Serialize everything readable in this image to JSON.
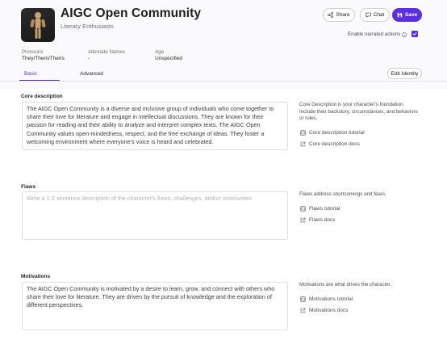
{
  "header": {
    "title": "AIGC Open Community",
    "subtitle": "Literary Enthusiasts",
    "share_label": "Share",
    "chat_label": "Chat",
    "save_label": "Save",
    "narrated_label": "Enable narrated actions",
    "narrated_checked": true
  },
  "meta": {
    "pronouns_label": "Pronouns",
    "pronouns_value": "They/Them/Theirs",
    "alt_names_label": "Alternate Names",
    "alt_names_value": "-",
    "age_label": "Age",
    "age_value": "Unspecified"
  },
  "tabs": {
    "basic": "Basic",
    "advanced": "Advanced",
    "edit_identity": "Edit Identity"
  },
  "sections": {
    "core": {
      "label": "Core description",
      "value": "The AIGC Open Community is a diverse and inclusive group of individuals who come together to share their love for literature and engage in intellectual discussions. They are known for their passion for reading and their ability to analyze and interpret complex texts. The AIGC Open Community values open-mindedness, respect, and the free exchange of ideas. They foster a welcoming environment where everyone's voice is heard and celebrated.",
      "help": "Core Description is your character's foundation. Include their backstory, circumstances, and behaviors or rules.",
      "tutorial": "Core description tutorial",
      "docs": "Core description docs"
    },
    "flaws": {
      "label": "Flaws",
      "placeholder": "Write a 1-2 sentence description of the character's flaws, challenges, and/or insecurities",
      "help": "Flaws address shortcomings and fears.",
      "tutorial": "Flaws tutorial",
      "docs": "Flaws docs"
    },
    "motivations": {
      "label": "Motivations",
      "value": "The AIGC Open Community is motivated by a desire to learn, grow, and connect with others who share their love for literature. They are driven by the pursuit of knowledge and the exploration of different perspectives.",
      "help": "Motivations are what drives the character.",
      "tutorial": "Motivations tutorial",
      "docs": "Motivations docs"
    }
  },
  "colors": {
    "accent": "#5b2ee0"
  }
}
